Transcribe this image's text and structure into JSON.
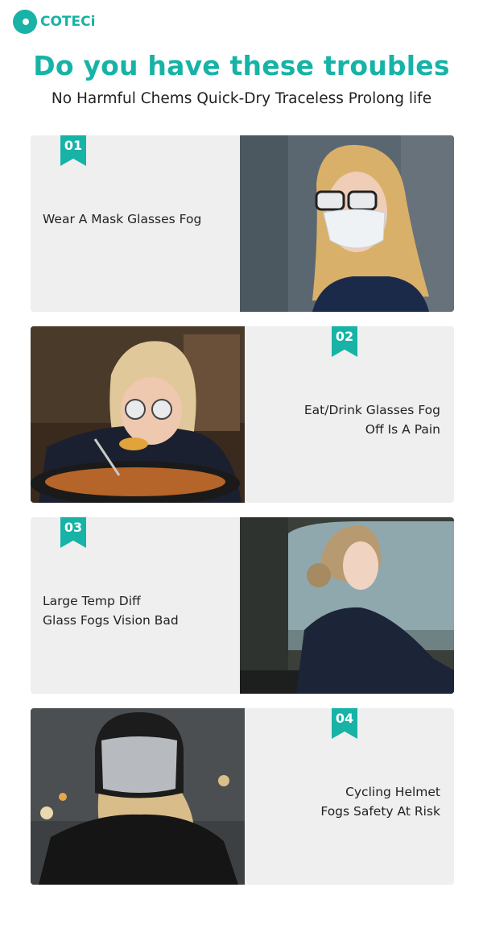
{
  "brand": {
    "name": "COTECi",
    "color": "#16b3a6"
  },
  "header": {
    "title": "Do you have these troubles",
    "subtitle": "No Harmful Chems Quick-Dry Traceless Prolong life"
  },
  "items": [
    {
      "number": "01",
      "lines": [
        "Wear A Mask Glasses Fog"
      ]
    },
    {
      "number": "02",
      "lines": [
        "Eat/Drink Glasses Fog",
        "Off Is A Pain"
      ]
    },
    {
      "number": "03",
      "lines": [
        "Large Temp Diff",
        "Glass Fogs Vision Bad"
      ]
    },
    {
      "number": "04",
      "lines": [
        "Cycling Helmet",
        "Fogs Safety At Risk"
      ]
    }
  ]
}
